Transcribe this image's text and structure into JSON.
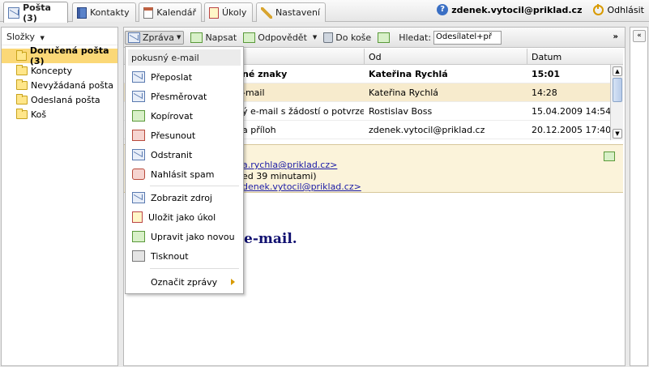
{
  "tabs": [
    {
      "label": "Pošta (3)",
      "icon": "mail-icon",
      "active": true
    },
    {
      "label": "Kontakty",
      "icon": "contacts-icon",
      "active": false
    },
    {
      "label": "Kalendář",
      "icon": "calendar-icon",
      "active": false
    },
    {
      "label": "Úkoly",
      "icon": "tasks-icon",
      "active": false
    },
    {
      "label": "Nastavení",
      "icon": "settings-icon",
      "active": false
    }
  ],
  "user": {
    "email": "zdenek.vytocil@priklad.cz",
    "logout_label": "Odhlásit"
  },
  "sidebar": {
    "title": "Složky",
    "folders": [
      {
        "label": "Doručená pošta (3)",
        "selected": true
      },
      {
        "label": "Koncepty",
        "selected": false
      },
      {
        "label": "Nevyžádaná pošta",
        "selected": false
      },
      {
        "label": "Odeslaná pošta",
        "selected": false
      },
      {
        "label": "Koš",
        "selected": false
      }
    ]
  },
  "toolbar": {
    "message_label": "Zpráva",
    "compose_label": "Napsat",
    "reply_label": "Odpovědět",
    "trash_label": "Do koše",
    "search_label": "Hledat:",
    "search_select_value": "Odesílatel+př",
    "expand_label": "»"
  },
  "list": {
    "columns": {
      "subject": "",
      "from": "Od",
      "date": "Datum"
    },
    "rows": [
      {
        "subject": "né znaky",
        "from": "Kateřina Rychlá",
        "date": "15:01",
        "bold": true,
        "selected": false
      },
      {
        "subject": "-mail",
        "from": "Kateřina Rychlá",
        "date": "14:28",
        "bold": false,
        "selected": true
      },
      {
        "subject": "ý e-mail s žádostí o potvrzení p",
        "from": "Rostislav Boss",
        "date": "15.04.2009 14:54",
        "bold": false,
        "selected": false
      },
      {
        "subject": "a příloh",
        "from": "zdenek.vytocil@priklad.cz",
        "date": "20.12.2005 17:40",
        "bold": false,
        "selected": false
      }
    ]
  },
  "preview": {
    "from_fragment": "a.rychla@priklad.cz>",
    "date_fragment": "ed 39 minutami)",
    "to_fragment": "denek.vytocil@priklad.cz>",
    "body_fragment": "e-mail."
  },
  "menu": {
    "header": "pokusný e-mail",
    "items": [
      {
        "label": "Přeposlat",
        "icon": "forward-icon"
      },
      {
        "label": "Přesměrovat",
        "icon": "redirect-icon"
      },
      {
        "label": "Kopírovat",
        "icon": "copy-icon"
      },
      {
        "label": "Přesunout",
        "icon": "move-icon"
      },
      {
        "label": "Odstranit",
        "icon": "delete-icon"
      },
      {
        "label": "Nahlásit spam",
        "icon": "spam-icon"
      },
      {
        "label": "Zobrazit zdroj",
        "icon": "view-source-icon"
      },
      {
        "label": "Uložit jako úkol",
        "icon": "save-task-icon"
      },
      {
        "label": "Upravit jako novou",
        "icon": "edit-new-icon"
      },
      {
        "label": "Tisknout",
        "icon": "print-icon"
      },
      {
        "label": "Označit zprávy",
        "icon": "submenu-arrow-icon"
      }
    ]
  }
}
